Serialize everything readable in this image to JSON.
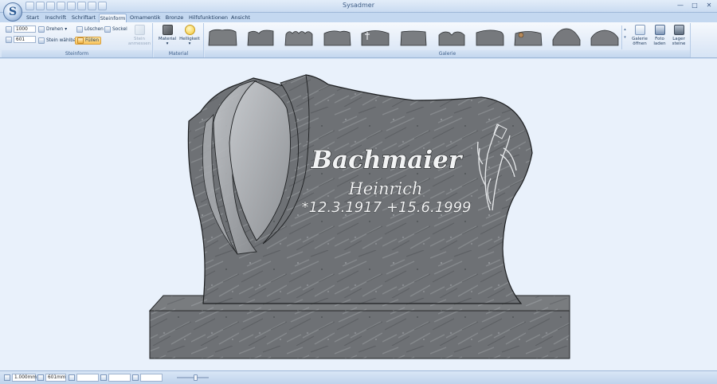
{
  "window": {
    "title": "Sysadmer"
  },
  "tabs": [
    "Start",
    "Inschrift",
    "Schriftart",
    "Steinform",
    "Ornamentik",
    "Bronze",
    "Hilfsfunktionen",
    "Ansicht"
  ],
  "ribbon": {
    "steinform": {
      "label": "Steinform",
      "height_value": "1000",
      "width_value": "601",
      "drehen_label": "Drehen",
      "loeschen_label": "Löschen",
      "sockel_label": "Sockel",
      "stein_waehlbar_label": "Stein wählbar",
      "fuellen_label": "Füllen",
      "stein_anmessen_label": "Stein anmessen"
    },
    "material": {
      "label": "Material",
      "material_label": "Material",
      "helligkeit_label": "Helligkeit"
    },
    "galerie": {
      "label": "Galerie",
      "oeffnen_label": "Galerie öffnen",
      "foto_label": "Foto laden",
      "lager_label": "Lager steine"
    }
  },
  "stone": {
    "name": "Bachmaier",
    "firstname": "Heinrich",
    "dates": "*12.3.1917 +15.6.1999"
  },
  "statusbar": {
    "height": "1.000mm",
    "width": "601mm",
    "field3": "",
    "field4": "",
    "field5": ""
  }
}
